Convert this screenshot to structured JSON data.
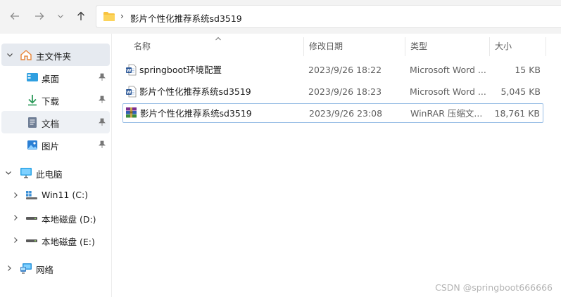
{
  "address_bar": {
    "separator": "›",
    "path": "影片个性化推荐系统sd3519"
  },
  "sidebar": {
    "home": "主文件夹",
    "quick_access": [
      {
        "label": "桌面",
        "icon": "desktop-icon"
      },
      {
        "label": "下载",
        "icon": "download-icon"
      },
      {
        "label": "文档",
        "icon": "document-icon"
      },
      {
        "label": "图片",
        "icon": "picture-icon"
      }
    ],
    "this_pc": "此电脑",
    "drives": [
      {
        "label": "Win11 (C:)",
        "icon": "windows-drive-icon"
      },
      {
        "label": "本地磁盘 (D:)",
        "icon": "drive-icon"
      },
      {
        "label": "本地磁盘 (E:)",
        "icon": "drive-icon"
      }
    ],
    "network": "网络"
  },
  "columns": {
    "name": "名称",
    "date": "修改日期",
    "type": "类型",
    "size": "大小"
  },
  "files": [
    {
      "name": "springboot环境配置",
      "date": "2023/9/26 18:22",
      "type": "Microsoft Word ...",
      "size": "15 KB",
      "icon": "word-icon"
    },
    {
      "name": "影片个性化推荐系统sd3519",
      "date": "2023/9/26 18:23",
      "type": "Microsoft Word ...",
      "size": "5,045 KB",
      "icon": "word-icon"
    },
    {
      "name": "影片个性化推荐系统sd3519",
      "date": "2023/9/26 23:08",
      "type": "WinRAR 压缩文...",
      "size": "18,761 KB",
      "icon": "winrar-icon"
    }
  ],
  "watermark": "CSDN @springboot666666",
  "colors": {
    "accent": "#0067c0",
    "folder": "#f8c33f",
    "selected_bg": "#e6eaf0",
    "focus_border": "#9cc0e6"
  }
}
